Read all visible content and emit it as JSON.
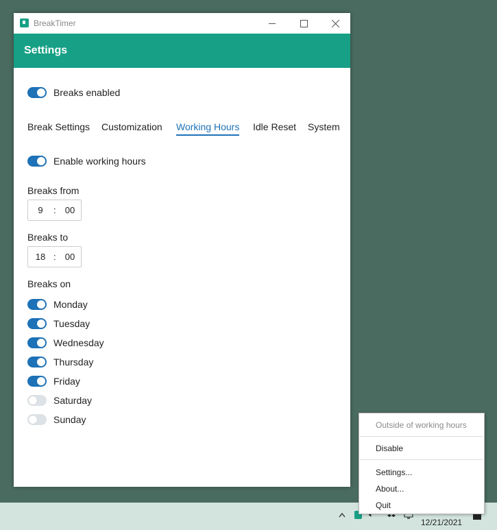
{
  "window": {
    "app_title": "BreakTimer",
    "header_title": "Settings",
    "breaks_enabled_label": "Breaks enabled",
    "breaks_enabled": true
  },
  "tabs": [
    {
      "label": "Break Settings",
      "active": false
    },
    {
      "label": "Customization",
      "active": false
    },
    {
      "label": "Working Hours",
      "active": true
    },
    {
      "label": "Idle Reset",
      "active": false
    },
    {
      "label": "System",
      "active": false
    }
  ],
  "working_hours": {
    "enable_label": "Enable working hours",
    "enabled": true,
    "from_label": "Breaks from",
    "from_hour": "9",
    "from_minute": "00",
    "to_label": "Breaks to",
    "to_hour": "18",
    "to_minute": "00",
    "time_separator": ":",
    "days_label": "Breaks on",
    "days": [
      {
        "label": "Monday",
        "on": true
      },
      {
        "label": "Tuesday",
        "on": true
      },
      {
        "label": "Wednesday",
        "on": true
      },
      {
        "label": "Thursday",
        "on": true
      },
      {
        "label": "Friday",
        "on": true
      },
      {
        "label": "Saturday",
        "on": false
      },
      {
        "label": "Sunday",
        "on": false
      }
    ]
  },
  "tray_menu": {
    "status": "Outside of working hours",
    "disable": "Disable",
    "settings": "Settings...",
    "about": "About...",
    "quit": "Quit"
  },
  "taskbar": {
    "date": "12/21/2021"
  },
  "colors": {
    "accent": "#17a085",
    "toggle_on": "#1e72b7",
    "desktop": "#4a6b60"
  }
}
